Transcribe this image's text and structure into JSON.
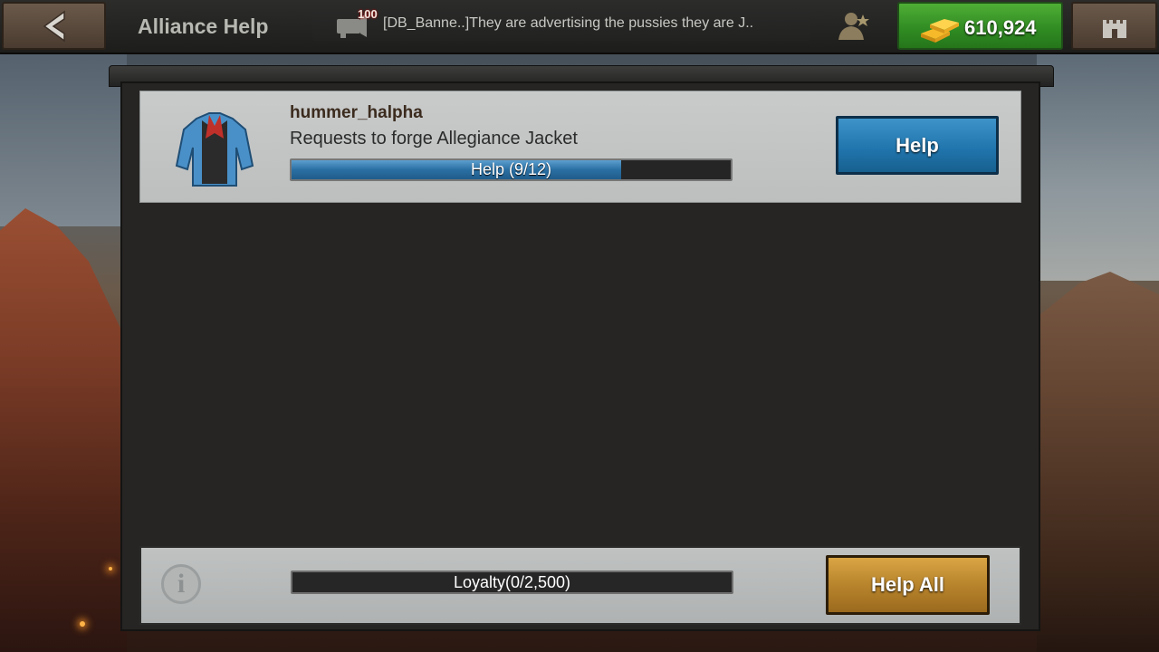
{
  "header": {
    "title": "Alliance Help",
    "chat": {
      "count": "100",
      "message": "[DB_Banne..]They are advertising the pussies they are J.."
    },
    "gold": "610,924"
  },
  "request": {
    "user": "hummer_halpha",
    "text": "Requests to forge Allegiance Jacket",
    "progress_label": "Help (9/12)",
    "progress": 0.75,
    "help_button": "Help"
  },
  "footer": {
    "loyalty_label": "Loyalty(0/2,500)",
    "loyalty_progress": 0,
    "help_all_button": "Help All",
    "info_glyph": "i"
  },
  "icons": {
    "back": "back-arrow-icon",
    "chat": "chat-megaphone-icon",
    "profile": "profile-medal-icon",
    "gold": "gold-bars-icon",
    "castle": "castle-icon",
    "item": "jacket-icon",
    "info": "info-icon"
  },
  "colors": {
    "help_blue": "#2176ae",
    "gold_green": "#3a9a28",
    "help_all_gold": "#b8842c"
  }
}
